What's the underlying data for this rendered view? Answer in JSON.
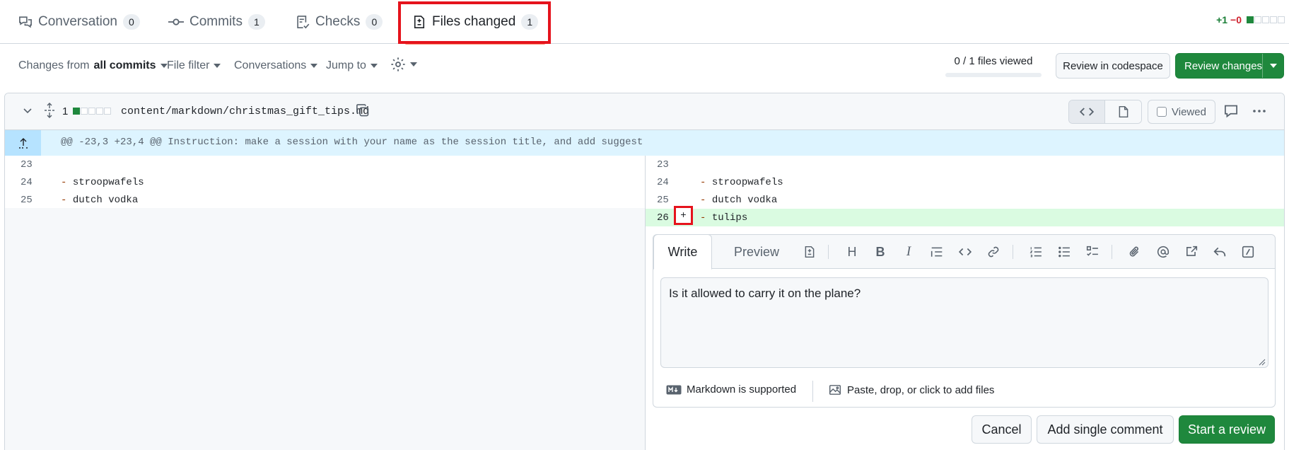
{
  "tabs": [
    {
      "label": "Conversation",
      "count": "0",
      "icon": "comment-discussion-icon"
    },
    {
      "label": "Commits",
      "count": "1",
      "icon": "git-commit-icon"
    },
    {
      "label": "Checks",
      "count": "0",
      "icon": "checklist-icon"
    },
    {
      "label": "Files changed",
      "count": "1",
      "icon": "file-diff-icon",
      "active": true
    }
  ],
  "diffstat": {
    "additions": "+1",
    "deletions": "−0",
    "bars": [
      "green",
      "gray",
      "gray",
      "gray",
      "gray"
    ]
  },
  "toolbar": {
    "changes_prefix": "Changes from",
    "changes_value": "all commits",
    "file_filter": "File filter",
    "conversations": "Conversations",
    "jump_to": "Jump to",
    "files_viewed": "0 / 1 files viewed",
    "files_viewed_fraction": 0,
    "review_codespace": "Review in codespace",
    "review_changes": "Review changes"
  },
  "file": {
    "changes_count": "1",
    "path": "content/markdown/christmas_gift_tips.md",
    "viewed_label": "Viewed",
    "hunk_header": "@@ -23,3 +23,4 @@ Instruction: make a session with your name as the session title, and add suggest",
    "left_lines": [
      {
        "num": "23",
        "marker": "",
        "text": ""
      },
      {
        "num": "24",
        "marker": "-",
        "text": "stroopwafels"
      },
      {
        "num": "25",
        "marker": "-",
        "text": "dutch vodka"
      }
    ],
    "right_lines": [
      {
        "num": "23",
        "marker": "",
        "text": ""
      },
      {
        "num": "24",
        "marker": "-",
        "text": "stroopwafels"
      },
      {
        "num": "25",
        "marker": "-",
        "text": "dutch vodka"
      },
      {
        "num": "26",
        "marker": "-",
        "text": "tulips",
        "added": true
      }
    ],
    "plus_glyph": "+"
  },
  "comment": {
    "write_tab": "Write",
    "preview_tab": "Preview",
    "text": "Is it allowed to carry it on the plane?",
    "markdown_note": "Markdown is supported",
    "attach_note": "Paste, drop, or click to add files",
    "cancel": "Cancel",
    "add_single": "Add single comment",
    "start_review": "Start a review"
  },
  "colors": {
    "accent_green": "#1f883d",
    "highlight_red": "#e5131c",
    "hunk_blue": "#ddf4ff",
    "added_line": "#dafbe1"
  }
}
